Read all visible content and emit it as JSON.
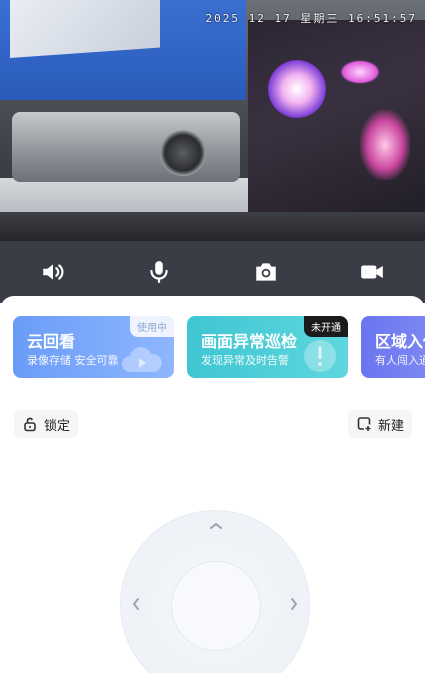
{
  "video": {
    "timestamp": "2025 12 17 星期三 16:51:57"
  },
  "toolbar": {
    "items": [
      {
        "icon": "speaker-icon"
      },
      {
        "icon": "microphone-icon"
      },
      {
        "icon": "camera-icon"
      },
      {
        "icon": "video-record-icon"
      }
    ]
  },
  "cards": [
    {
      "title": "云回看",
      "subtitle": "录像存储 安全可靠",
      "badge": "使用中"
    },
    {
      "title": "画面异常巡检",
      "subtitle": "发现异常及时告警",
      "badge": "未开通"
    },
    {
      "title": "区域入侵",
      "subtitle": "有人闯入通"
    }
  ],
  "actions": {
    "lock_label": "锁定",
    "new_label": "新建"
  },
  "colors": {
    "toolbar_bg": "#3a3d45",
    "card1": "#6a9cf7",
    "card2": "#3fc6d2",
    "card3": "#6a76ef"
  }
}
